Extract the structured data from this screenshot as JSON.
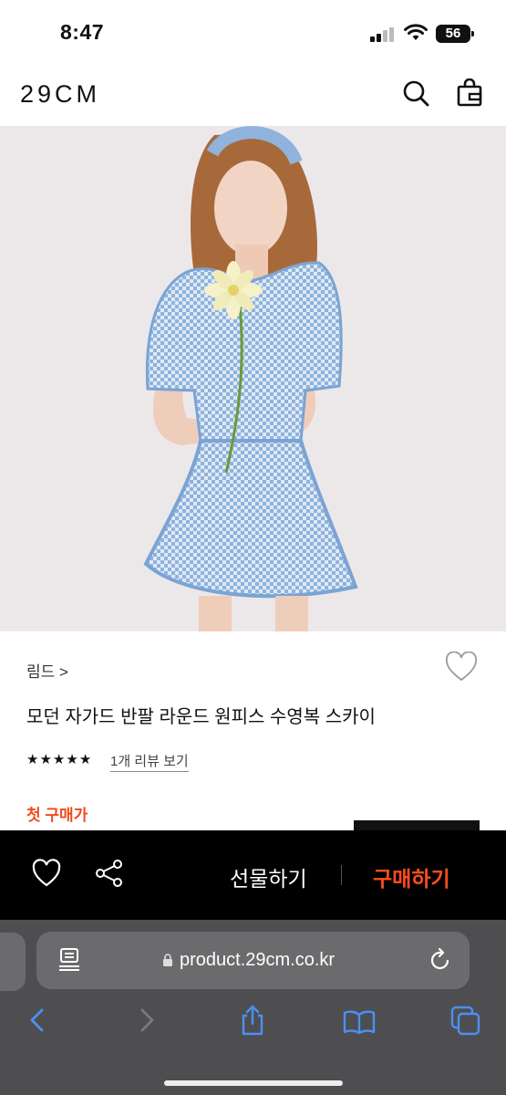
{
  "status": {
    "time": "8:47",
    "battery": "56"
  },
  "header": {
    "logo": "29CM",
    "search_icon": "search-icon",
    "bag_icon": "shopping-bag-icon"
  },
  "product": {
    "brand": "림드 >",
    "title": "모던 자가드 반팔 라운드 원피스 수영복 스카이",
    "rating_stars": 5,
    "review_link": "1개 리뷰 보기",
    "first_buy_label": "첫 구매가"
  },
  "buybar": {
    "gift_label": "선물하기",
    "buy_label": "구매하기"
  },
  "browser": {
    "url": "product.29cm.co.kr"
  },
  "colors": {
    "accent": "#ff4d1e",
    "first_buy": "#ef4a1d",
    "dress": "#8fb3dc",
    "hero_bg": "#ece8ea"
  }
}
